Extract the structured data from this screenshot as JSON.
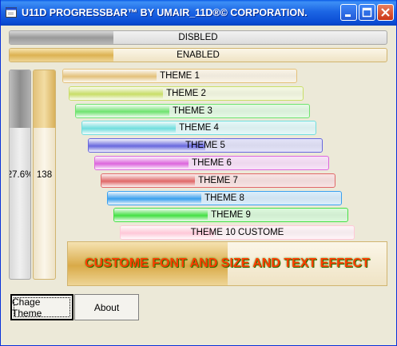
{
  "window": {
    "title": "U11D PROGRESSBAR™ BY UMAIR_11D®© CORPORATION."
  },
  "bars": {
    "disabled": {
      "label": "DISBLED",
      "progress": 0.275
    },
    "enabled": {
      "label": "ENABLED",
      "progress": 0.275
    },
    "vertical_percent": {
      "label": "27.6%",
      "progress": 0.276
    },
    "vertical_value": {
      "label": "138",
      "progress": 0.276
    },
    "themes": [
      {
        "label": "THEME 1",
        "progress": 0.4,
        "color": "#e4c17a"
      },
      {
        "label": "THEME 2",
        "progress": 0.4,
        "color": "#c9de68"
      },
      {
        "label": "THEME 3",
        "progress": 0.4,
        "color": "#6fe36f"
      },
      {
        "label": "THEME 4",
        "progress": 0.4,
        "color": "#70dede"
      },
      {
        "label": "THEME 5",
        "progress": 0.5,
        "color": "#6868de"
      },
      {
        "label": "THEME 6",
        "progress": 0.4,
        "color": "#dd66dd"
      },
      {
        "label": "THEME 7",
        "progress": 0.4,
        "color": "#e06868"
      },
      {
        "label": "THEME 8",
        "progress": 0.4,
        "color": "#3aa0ee"
      },
      {
        "label": "THEME 9",
        "progress": 0.4,
        "color": "#44e044"
      },
      {
        "label": "THEME 10 CUSTOME",
        "progress": 0.4,
        "color": "#ffc8d8"
      }
    ],
    "custom": {
      "label": "CUSTOME FONT AND SIZE AND TEXT EFFECT",
      "progress": 0.5
    }
  },
  "buttons": {
    "change_theme": "Chage Theme",
    "about": "About"
  },
  "colors": {
    "title_bar": "#0a5be6",
    "window_bg": "#ece9d8",
    "gold": "#e4c17a",
    "custom_text": "#ff3b00"
  }
}
